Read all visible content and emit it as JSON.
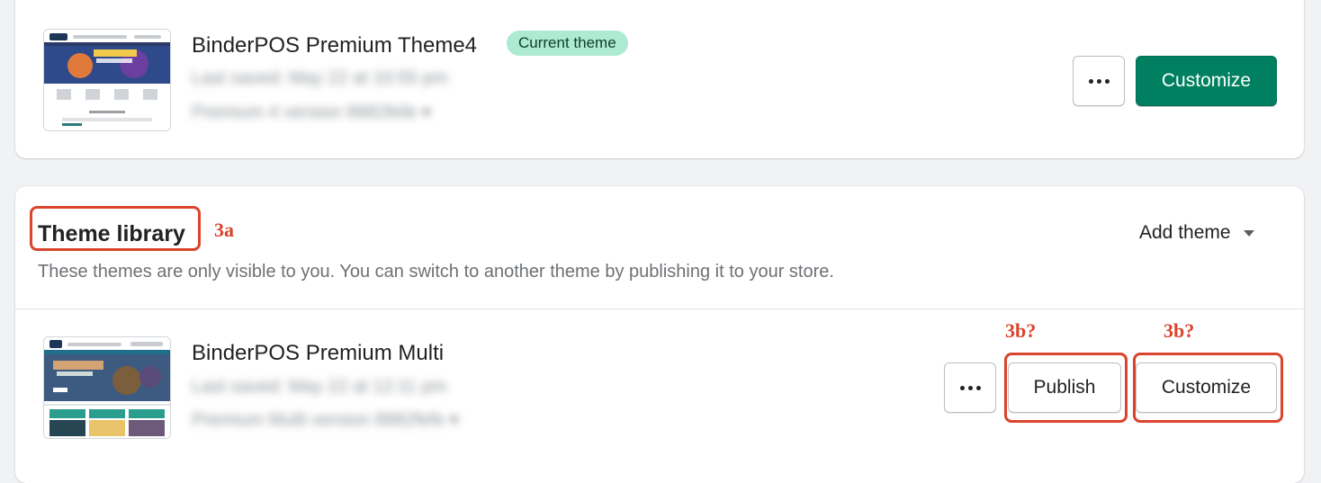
{
  "current_theme": {
    "name": "BinderPOS Premium Theme4",
    "badge": "Current theme",
    "last_saved": "Last saved: May 22 at 10:55 pm",
    "version": "Premium 4 version 8882fefe",
    "more_label": "More actions",
    "customize_label": "Customize"
  },
  "library": {
    "title": "Theme library",
    "description": "These themes are only visible to you. You can switch to another theme by publishing it to your store.",
    "add_theme_label": "Add theme",
    "themes": [
      {
        "name": "BinderPOS Premium Multi",
        "last_saved": "Last saved: May 22 at 12:11 pm",
        "version": "Premium Multi version 8882fefe",
        "more_label": "More actions",
        "publish_label": "Publish",
        "customize_label": "Customize"
      }
    ]
  },
  "annotations": {
    "title_label": "3a",
    "publish_label": "3b?",
    "customize_label": "3b?"
  },
  "colors": {
    "primary": "#008060",
    "badge_bg": "#aee9d1",
    "annotation": "#d9442c"
  }
}
